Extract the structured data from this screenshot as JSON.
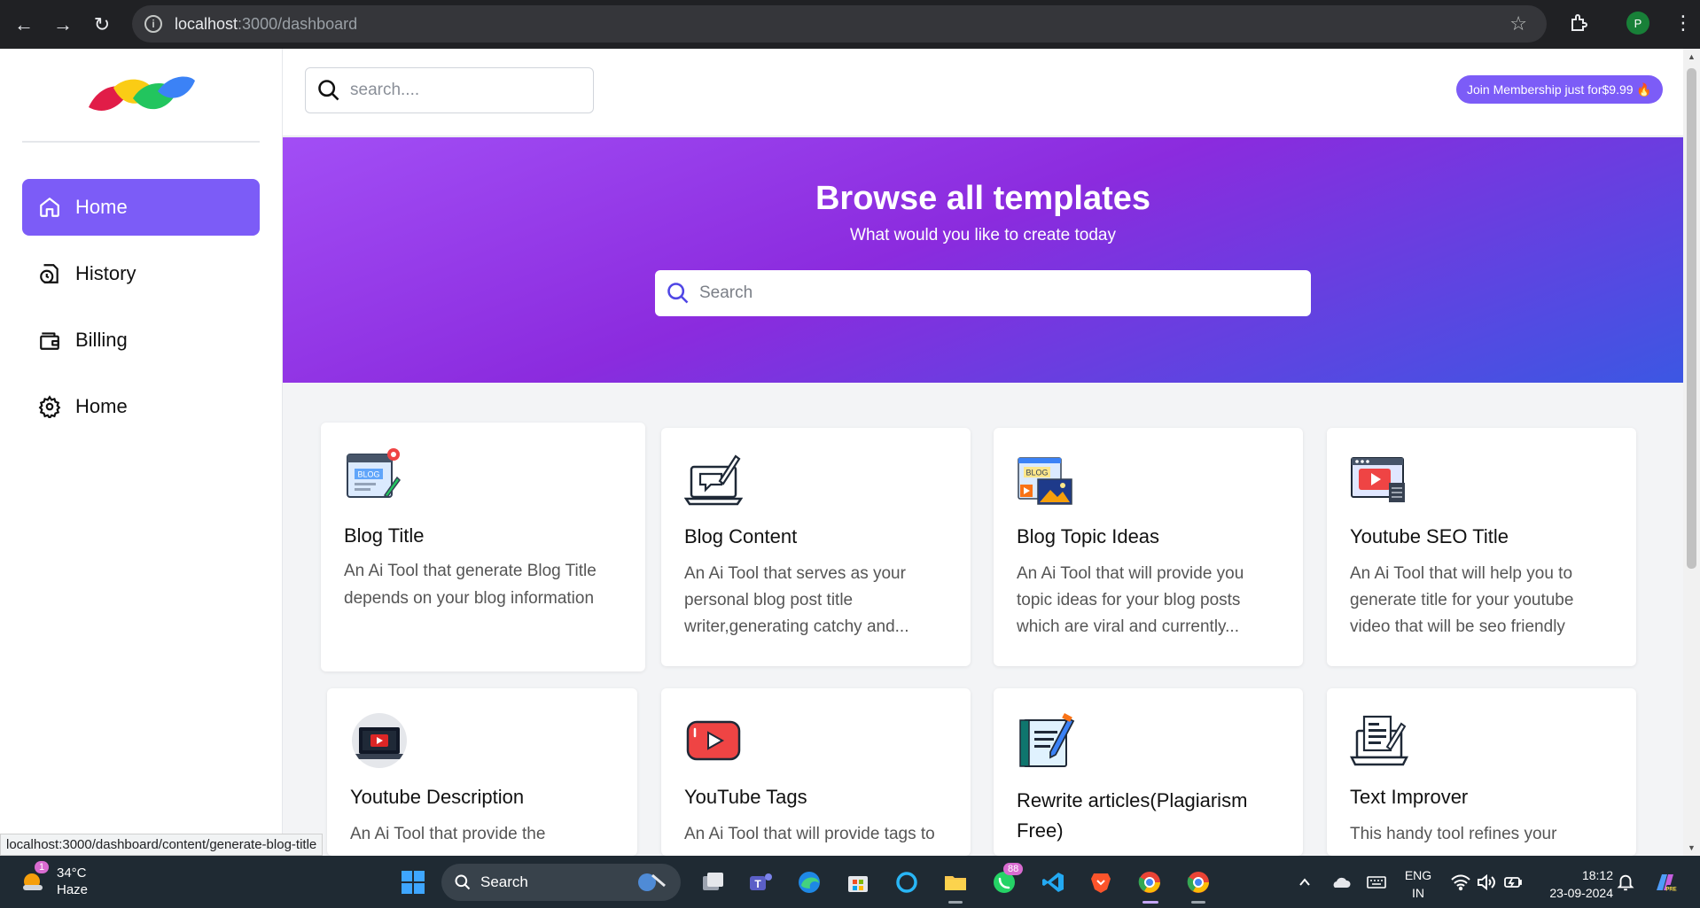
{
  "browser": {
    "url_host": "localhost",
    "url_rest": ":3000/dashboard",
    "profile_initial": "P"
  },
  "sidebar": {
    "items": [
      {
        "label": "Home",
        "icon": "home-icon",
        "active": true
      },
      {
        "label": "History",
        "icon": "history-icon",
        "active": false
      },
      {
        "label": "Billing",
        "icon": "wallet-icon",
        "active": false
      },
      {
        "label": "Home",
        "icon": "gear-icon",
        "active": false
      }
    ]
  },
  "header": {
    "search_placeholder": "search....",
    "membership_label": "Join Membership just for$9.99 🔥"
  },
  "hero": {
    "title": "Browse all templates",
    "subtitle": "What would you like to create today",
    "search_placeholder": "Search"
  },
  "templates": [
    {
      "title": "Blog Title",
      "desc": "An Ai Tool that generate Blog Title depends on your blog information",
      "icon": "blog-window-icon"
    },
    {
      "title": "Blog Content",
      "desc": "An Ai Tool that serves as your personal blog post title writer,generating catchy and...",
      "icon": "laptop-writing-icon"
    },
    {
      "title": "Blog Topic Ideas",
      "desc": "An Ai Tool that will provide you topic ideas for your blog posts which are viral and currently...",
      "icon": "blog-media-icon"
    },
    {
      "title": "Youtube SEO Title",
      "desc": "An Ai Tool that will help you to generate title for your youtube video that will be seo friendly",
      "icon": "video-browser-icon"
    },
    {
      "title": "Youtube Description",
      "desc": "An Ai Tool that provide the",
      "icon": "laptop-play-icon"
    },
    {
      "title": "YouTube Tags",
      "desc": "An Ai Tool that will provide tags to",
      "icon": "youtube-icon"
    },
    {
      "title": "Rewrite articles(Plagiarism Free)",
      "desc": "",
      "icon": "notebook-pen-icon"
    },
    {
      "title": "Text Improver",
      "desc": "This handy tool refines your",
      "icon": "laptop-document-icon"
    }
  ],
  "status_bar": {
    "hover_url": "localhost:3000/dashboard/content/generate-blog-title"
  },
  "taskbar": {
    "weather_badge": "1",
    "temperature": "34°C",
    "condition": "Haze",
    "search_label": "Search",
    "whatsapp_badge": "88",
    "lang_top": "ENG",
    "lang_bottom": "IN",
    "time": "18:12",
    "date": "23-09-2024"
  },
  "colors": {
    "accent": "#7c5cf7",
    "hero_gradient_start": "#a24ef5",
    "hero_gradient_end": "#3c57e3"
  }
}
